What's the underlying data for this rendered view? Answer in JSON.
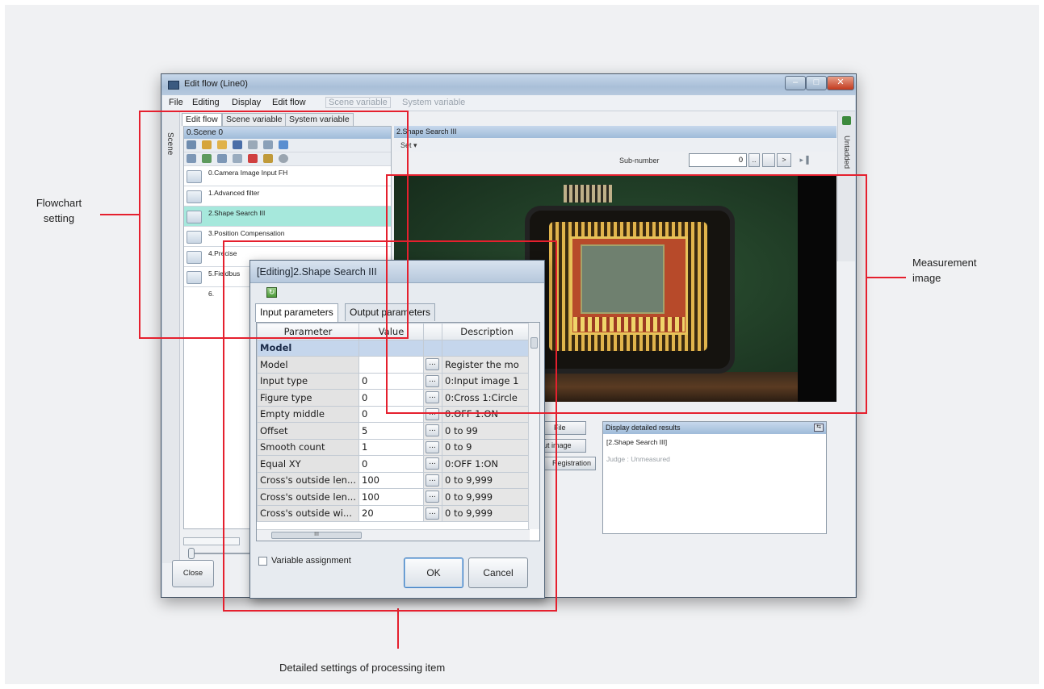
{
  "window": {
    "title": "Edit flow (Line0)"
  },
  "menu": {
    "file": "File",
    "editing": "Editing",
    "display": "Display",
    "edit_flow": "Edit flow",
    "scene_variable": "Scene variable",
    "system_variable": "System variable"
  },
  "left": {
    "vertical_tab": "Scene",
    "tabs": [
      "Edit flow",
      "Scene variable",
      "System variable"
    ],
    "scene_header": "0.Scene 0",
    "flow_items": [
      "0.Camera Image Input FH",
      "1.Advanced filter",
      "2.Shape Search III",
      "3.Position Compensation",
      "4.Precise",
      "5.Fieldbus",
      "6."
    ],
    "selected_index": 2
  },
  "right": {
    "proc_header": "2.Shape Search III",
    "set_label": "Set ▾",
    "subnumber_label": "Sub-number",
    "subnumber_value": "0",
    "nav_prev": "..",
    "nav_next": ">",
    "nav_end": "▸▐",
    "strip_label": "Untadded",
    "btn_file": "File",
    "btn_input_image": "ut image",
    "btn_registration": "Registration",
    "detail_header": "Display detailed results",
    "detail_item": "[2.Shape Search III]",
    "detail_judge": "Judge : Unmeasured",
    "close_button": "Close"
  },
  "dialog": {
    "title": "[Editing]2.Shape Search III",
    "refresh_icon": "↻",
    "tabs": [
      "Input parameters",
      "Output parameters"
    ],
    "columns": [
      "Parameter",
      "Value",
      "",
      "Description"
    ],
    "group": "Model",
    "ellipsis": "...",
    "rows": [
      {
        "name": "Model",
        "value": "",
        "desc": "Register the mo"
      },
      {
        "name": "Input type",
        "value": "0",
        "desc": "0:Input image 1"
      },
      {
        "name": "Figure type",
        "value": "0",
        "desc": "0:Cross 1:Circle"
      },
      {
        "name": "Empty middle",
        "value": "0",
        "desc": "0:OFF 1:ON"
      },
      {
        "name": "Offset",
        "value": "5",
        "desc": "0 to 99"
      },
      {
        "name": "Smooth count",
        "value": "1",
        "desc": "0 to 9"
      },
      {
        "name": "Equal XY",
        "value": "0",
        "desc": "0:OFF 1:ON"
      },
      {
        "name": "Cross's outside len...",
        "value": "100",
        "desc": "0 to 9,999"
      },
      {
        "name": "Cross's outside len...",
        "value": "100",
        "desc": "0 to 9,999"
      },
      {
        "name": "Cross's outside wi...",
        "value": "20",
        "desc": "0 to 9,999"
      }
    ],
    "hscroll_grip": "III",
    "variable_assignment": "Variable assignment",
    "ok": "OK",
    "cancel": "Cancel"
  },
  "callouts": {
    "flowchart": "Flowchart\nsetting",
    "measurement": "Measurement\nimage",
    "detailed": "Detailed settings of processing item"
  },
  "colors": {
    "callout_red": "#e5202e",
    "selected_row": "#a6e8dc",
    "header_blue": "#9fbbd9"
  }
}
